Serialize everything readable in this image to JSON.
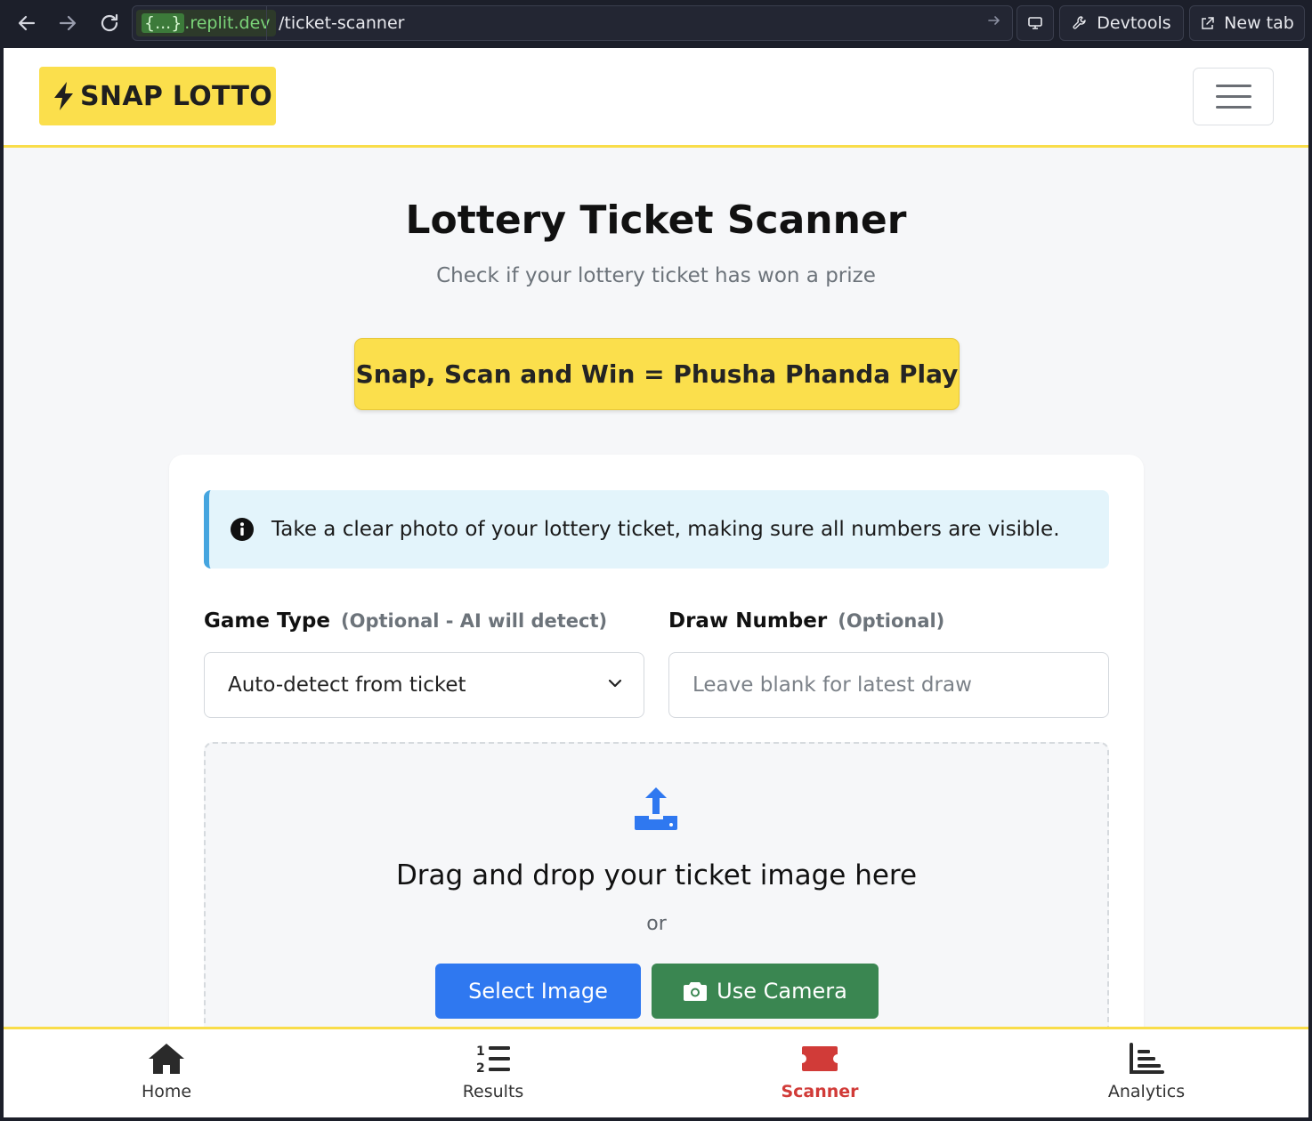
{
  "browser": {
    "url_host_badge": "{...}",
    "url_host": ".replit.dev",
    "url_path": "/ticket-scanner",
    "devtools_label": "Devtools",
    "new_tab_label": "New tab"
  },
  "header": {
    "logo_text": "SNAP LOTTO",
    "accent_color": "#fbdf4c"
  },
  "main": {
    "title": "Lottery Ticket Scanner",
    "subtitle": "Check if your lottery ticket has won a prize",
    "promo_button": "Snap, Scan and Win = Phusha Phanda Play"
  },
  "card": {
    "alert_text": "Take a clear photo of your lottery ticket, making sure all numbers are visible.",
    "game_type": {
      "label": "Game Type",
      "hint": "(Optional - AI will detect)",
      "selected": "Auto-detect from ticket"
    },
    "draw_number": {
      "label": "Draw Number",
      "hint": "(Optional)",
      "value": "",
      "placeholder": "Leave blank for latest draw"
    },
    "dropzone": {
      "title": "Drag and drop your ticket image here",
      "or_text": "or",
      "select_button": "Select Image",
      "camera_button": "Use Camera"
    }
  },
  "bottom_nav": {
    "items": [
      {
        "label": "Home",
        "icon": "home-icon",
        "active": false
      },
      {
        "label": "Results",
        "icon": "list-numbered-icon",
        "active": false
      },
      {
        "label": "Scanner",
        "icon": "ticket-icon",
        "active": true
      },
      {
        "label": "Analytics",
        "icon": "chart-bar-icon",
        "active": false
      }
    ],
    "active_color": "#d13b38"
  }
}
